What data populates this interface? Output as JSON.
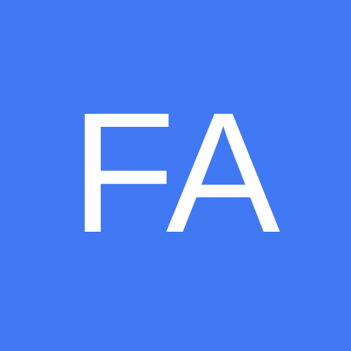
{
  "avatar": {
    "initials": "FA",
    "background_color": "#4179F5",
    "text_color": "#FFFFFF"
  }
}
